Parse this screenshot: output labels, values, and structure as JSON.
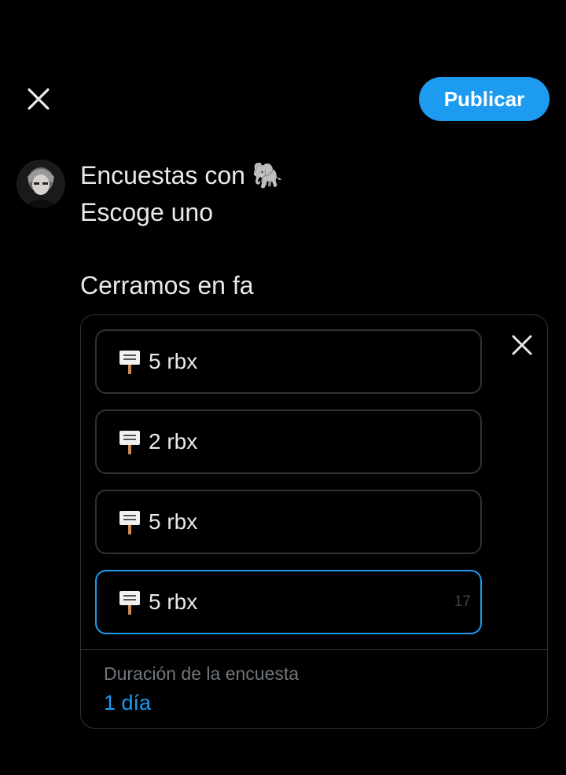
{
  "header": {
    "close_icon": "close-icon",
    "publish_label": "Publicar"
  },
  "compose": {
    "avatar_icon": "avatar",
    "line1": "Encuestas con 🐘",
    "line2": "Escoge uno",
    "line3": "Cerramos en fa"
  },
  "poll": {
    "close_icon": "close-icon",
    "options": [
      {
        "text": "5 rbx"
      },
      {
        "text": "2 rbx"
      },
      {
        "text": "5 rbx"
      },
      {
        "text": "5 rbx",
        "counter": "17"
      }
    ],
    "duration_label": "Duración de la encuesta",
    "duration_value": "1 día"
  },
  "colors": {
    "accent": "#1d9bf0",
    "background": "#000000",
    "border": "#2f3336",
    "muted": "#71767b"
  }
}
